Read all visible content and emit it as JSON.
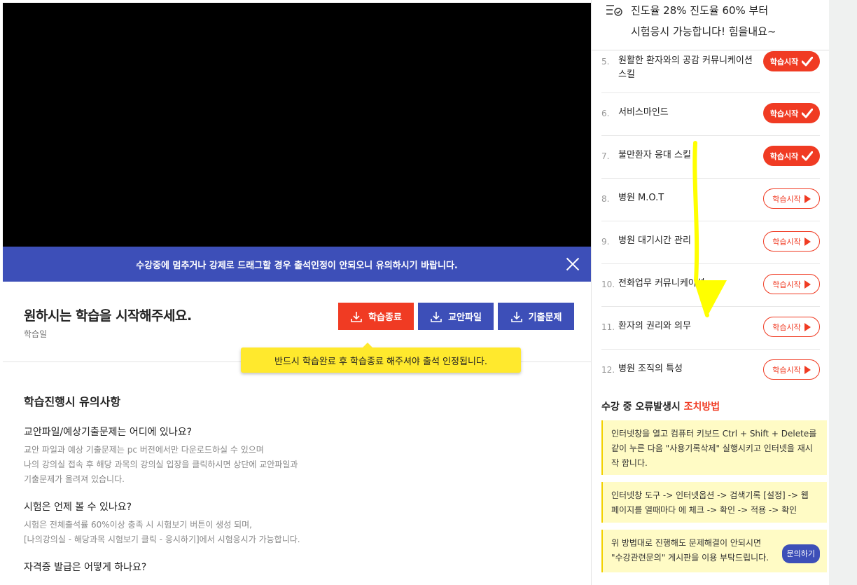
{
  "notice": {
    "text": "수강중에 멈추거나 강제로 드래그할 경우 출석인정이 안되오니 유의하시기 바랍니다."
  },
  "start": {
    "title": "원하시는 학습을 시작해주세요.",
    "subtitle": "학습일",
    "buttons": {
      "end": "학습종료",
      "file": "교안파일",
      "exam": "기출문제"
    },
    "tooltip": "반드시 학습완료 후 학습종료 해주셔야 출석 인정됩니다."
  },
  "guide": {
    "title": "학습진행시 유의사항",
    "faqs": [
      {
        "q": "교안파일/예상기출문제는 어디에 있나요?",
        "a1": "교안 파일과 예상 기출문제는 pc 버전에서만 다운로드하실 수 있으며",
        "a2": "나의 강의실 접속 후 해당 과목의 강의실 입장을 클릭하시면 상단에 교안파일과",
        "a3": "기출문제가 올려져 있습니다."
      },
      {
        "q": "시험은 언제 볼 수 있나요?",
        "a1": "시험은 전체출석률 60%이상 충족 시 시험보기 버튼이 생성 되며,",
        "a2": "[나의강의실 - 해당과목 시험보기 클릭 - 응시하기]에서 시험응시가 가능합니다."
      },
      {
        "q": "자격증 발급은 어떻게 하나요?"
      }
    ]
  },
  "progress": {
    "line1": "진도율 28% 진도율 60% 부터",
    "line2": "시험응시 가능합니다! 힘을내요~"
  },
  "lessons": [
    {
      "num": "5.",
      "title": "원활한 환자와의 공감 커뮤니케이션 스킬",
      "button": "학습시작",
      "done": true
    },
    {
      "num": "6.",
      "title": "서비스마인드",
      "button": "학습시작",
      "done": true
    },
    {
      "num": "7.",
      "title": "불만환자 응대 스킬",
      "button": "학습시작",
      "done": true
    },
    {
      "num": "8.",
      "title": "병원 M.O.T",
      "button": "학습시작",
      "done": false
    },
    {
      "num": "9.",
      "title": "병원 대기시간 관리",
      "button": "학습시작",
      "done": false
    },
    {
      "num": "10.",
      "title": "전화업무 커뮤니케이션",
      "button": "학습시작",
      "done": false
    },
    {
      "num": "11.",
      "title": "환자의 권리와 의무",
      "button": "학습시작",
      "done": false
    },
    {
      "num": "12.",
      "title": "병원 조직의 특성",
      "button": "학습시작",
      "done": false
    }
  ],
  "error_help": {
    "title": "수강 중 오류발생시",
    "title_highlight": "조치방법",
    "box1": "인터넷창을 열고 컴퓨터 키보드 Ctrl + Shift + Delete를 같이 누른 다음 \"사용기록삭제\" 실행시키고 인터넷을 재시작 합니다.",
    "box2": "인터넷창 도구 -> 인터넷옵션 -> 검색기록 [설정] -> 웹 페이지를 열때마다 에 체크 -> 확인 -> 적용 -> 확인",
    "box3_line1": "위 방법대로 진행해도 문제해결이 안되시면",
    "box3_line2": "\"수강관련문의\" 게시판을 이용 부탁드립니다.",
    "ask_button": "문의하기"
  },
  "colors": {
    "accent_red": "#f03b23",
    "accent_blue": "#3d4fb8",
    "tooltip_yellow": "#ffe92d",
    "annotation_yellow": "#ffff00"
  }
}
